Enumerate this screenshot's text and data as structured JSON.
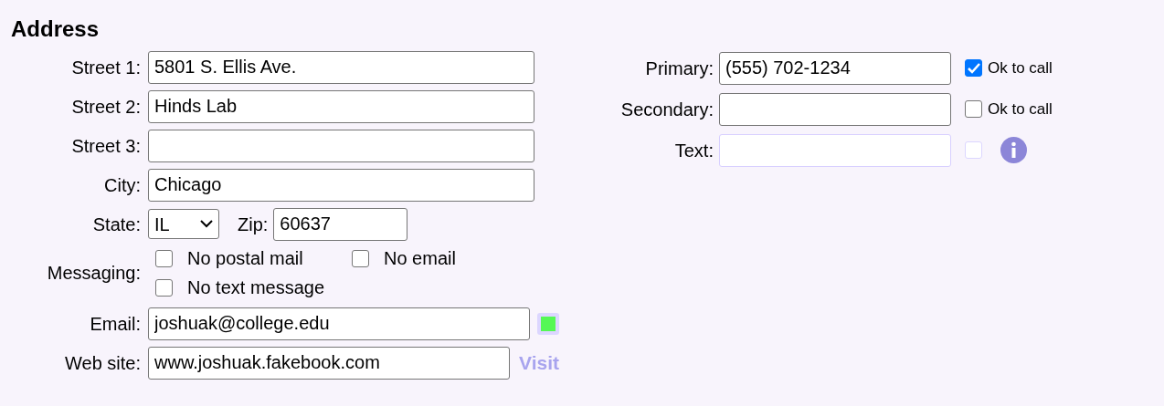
{
  "heading": "Address",
  "streets": [
    {
      "label": "Street 1:",
      "value": "5801 S. Ellis Ave."
    },
    {
      "label": "Street 2:",
      "value": "Hinds Lab"
    },
    {
      "label": "Street 3:"
    },
    {
      "label": "City:",
      "value": "Chicago"
    }
  ],
  "state": {
    "label": "State:",
    "value": "IL"
  },
  "zip": {
    "label": "Zip:",
    "value": "60637"
  },
  "messaging": {
    "label": "Messaging:",
    "options": [
      {
        "label": "No postal mail",
        "checked": false
      },
      {
        "label": "No email",
        "checked": false
      },
      {
        "label": "No text message",
        "checked": false
      }
    ]
  },
  "email": {
    "label": "Email:",
    "value": "joshuak@college.edu",
    "indicator": {
      "color": "#55f855"
    }
  },
  "website": {
    "label": "Web site:",
    "value": "www.joshuak.fakebook.com",
    "link": {
      "label": "Visit",
      "disabled": true
    }
  },
  "phones": [
    {
      "label": "Primary:",
      "value": "(555) 702-1234",
      "disabled": false,
      "ok_to_call": {
        "label": "Ok to call",
        "checked": true
      },
      "info": false
    },
    {
      "label": "Secondary:",
      "disabled": false,
      "ok_to_call": {
        "label": "Ok to call",
        "checked": false
      },
      "info": false
    },
    {
      "label": "Text:",
      "disabled": true,
      "ok_to_call": {
        "checked": false
      },
      "info": true
    }
  ]
}
